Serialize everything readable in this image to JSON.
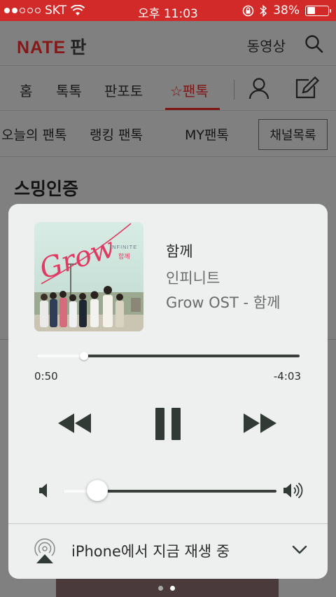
{
  "status_bar": {
    "carrier": "SKT",
    "time": "오후 11:03",
    "battery": "38%",
    "battery_level": 0.38
  },
  "header": {
    "logo": "NATE",
    "logo_suffix": "판",
    "video_label": "동영상",
    "search_icon": "search-icon"
  },
  "nav": {
    "tabs": [
      {
        "label": "홈"
      },
      {
        "label": "톡톡"
      },
      {
        "label": "판포토"
      },
      {
        "label": "☆팬톡"
      }
    ],
    "active_index": 3,
    "profile_icon": "person-icon",
    "write_icon": "pencil-icon"
  },
  "subnav": {
    "items": [
      {
        "label": "오늘의 팬톡"
      },
      {
        "label": "랭킹 팬톡"
      },
      {
        "label": "MY팬톡"
      }
    ],
    "channel_button": "채널목록"
  },
  "section": {
    "title": "스밍인증"
  },
  "player": {
    "song_title": "함께",
    "artist": "인피니트",
    "album": "Grow OST - 함께",
    "elapsed": "0:50",
    "remaining": "-4:03",
    "progress": 0.18,
    "volume": 0.16,
    "cover": {
      "script_text": "Grow",
      "band_text": "INFINITE",
      "song_text": "함께"
    },
    "airplay_label": "iPhone에서 지금 재생 중",
    "icons": {
      "rewind": "rewind-icon",
      "pause": "pause-icon",
      "forward": "fast-forward-icon",
      "volume_low": "volume-low-icon",
      "volume_high": "volume-high-icon",
      "airplay": "airplay-icon",
      "chevron": "chevron-down-icon"
    }
  },
  "pagination": {
    "count": 2,
    "active": 1
  }
}
